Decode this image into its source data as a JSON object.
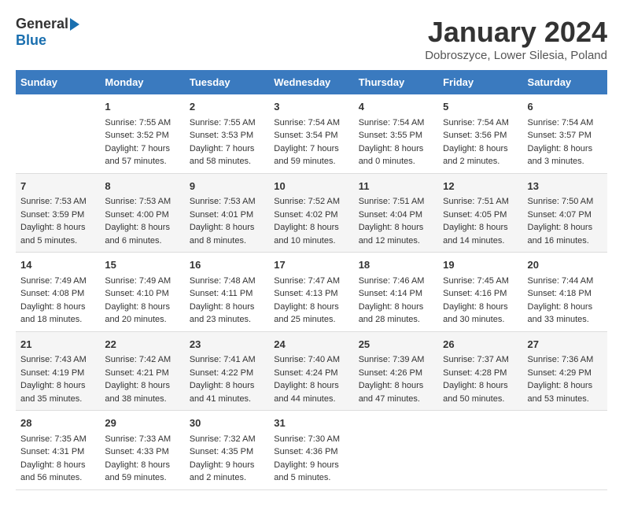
{
  "logo": {
    "general": "General",
    "blue": "Blue"
  },
  "title": "January 2024",
  "location": "Dobroszyce, Lower Silesia, Poland",
  "days_of_week": [
    "Sunday",
    "Monday",
    "Tuesday",
    "Wednesday",
    "Thursday",
    "Friday",
    "Saturday"
  ],
  "weeks": [
    [
      {
        "day": "",
        "content": ""
      },
      {
        "day": "1",
        "content": "Sunrise: 7:55 AM\nSunset: 3:52 PM\nDaylight: 7 hours\nand 57 minutes."
      },
      {
        "day": "2",
        "content": "Sunrise: 7:55 AM\nSunset: 3:53 PM\nDaylight: 7 hours\nand 58 minutes."
      },
      {
        "day": "3",
        "content": "Sunrise: 7:54 AM\nSunset: 3:54 PM\nDaylight: 7 hours\nand 59 minutes."
      },
      {
        "day": "4",
        "content": "Sunrise: 7:54 AM\nSunset: 3:55 PM\nDaylight: 8 hours\nand 0 minutes."
      },
      {
        "day": "5",
        "content": "Sunrise: 7:54 AM\nSunset: 3:56 PM\nDaylight: 8 hours\nand 2 minutes."
      },
      {
        "day": "6",
        "content": "Sunrise: 7:54 AM\nSunset: 3:57 PM\nDaylight: 8 hours\nand 3 minutes."
      }
    ],
    [
      {
        "day": "7",
        "content": "Sunrise: 7:53 AM\nSunset: 3:59 PM\nDaylight: 8 hours\nand 5 minutes."
      },
      {
        "day": "8",
        "content": "Sunrise: 7:53 AM\nSunset: 4:00 PM\nDaylight: 8 hours\nand 6 minutes."
      },
      {
        "day": "9",
        "content": "Sunrise: 7:53 AM\nSunset: 4:01 PM\nDaylight: 8 hours\nand 8 minutes."
      },
      {
        "day": "10",
        "content": "Sunrise: 7:52 AM\nSunset: 4:02 PM\nDaylight: 8 hours\nand 10 minutes."
      },
      {
        "day": "11",
        "content": "Sunrise: 7:51 AM\nSunset: 4:04 PM\nDaylight: 8 hours\nand 12 minutes."
      },
      {
        "day": "12",
        "content": "Sunrise: 7:51 AM\nSunset: 4:05 PM\nDaylight: 8 hours\nand 14 minutes."
      },
      {
        "day": "13",
        "content": "Sunrise: 7:50 AM\nSunset: 4:07 PM\nDaylight: 8 hours\nand 16 minutes."
      }
    ],
    [
      {
        "day": "14",
        "content": "Sunrise: 7:49 AM\nSunset: 4:08 PM\nDaylight: 8 hours\nand 18 minutes."
      },
      {
        "day": "15",
        "content": "Sunrise: 7:49 AM\nSunset: 4:10 PM\nDaylight: 8 hours\nand 20 minutes."
      },
      {
        "day": "16",
        "content": "Sunrise: 7:48 AM\nSunset: 4:11 PM\nDaylight: 8 hours\nand 23 minutes."
      },
      {
        "day": "17",
        "content": "Sunrise: 7:47 AM\nSunset: 4:13 PM\nDaylight: 8 hours\nand 25 minutes."
      },
      {
        "day": "18",
        "content": "Sunrise: 7:46 AM\nSunset: 4:14 PM\nDaylight: 8 hours\nand 28 minutes."
      },
      {
        "day": "19",
        "content": "Sunrise: 7:45 AM\nSunset: 4:16 PM\nDaylight: 8 hours\nand 30 minutes."
      },
      {
        "day": "20",
        "content": "Sunrise: 7:44 AM\nSunset: 4:18 PM\nDaylight: 8 hours\nand 33 minutes."
      }
    ],
    [
      {
        "day": "21",
        "content": "Sunrise: 7:43 AM\nSunset: 4:19 PM\nDaylight: 8 hours\nand 35 minutes."
      },
      {
        "day": "22",
        "content": "Sunrise: 7:42 AM\nSunset: 4:21 PM\nDaylight: 8 hours\nand 38 minutes."
      },
      {
        "day": "23",
        "content": "Sunrise: 7:41 AM\nSunset: 4:22 PM\nDaylight: 8 hours\nand 41 minutes."
      },
      {
        "day": "24",
        "content": "Sunrise: 7:40 AM\nSunset: 4:24 PM\nDaylight: 8 hours\nand 44 minutes."
      },
      {
        "day": "25",
        "content": "Sunrise: 7:39 AM\nSunset: 4:26 PM\nDaylight: 8 hours\nand 47 minutes."
      },
      {
        "day": "26",
        "content": "Sunrise: 7:37 AM\nSunset: 4:28 PM\nDaylight: 8 hours\nand 50 minutes."
      },
      {
        "day": "27",
        "content": "Sunrise: 7:36 AM\nSunset: 4:29 PM\nDaylight: 8 hours\nand 53 minutes."
      }
    ],
    [
      {
        "day": "28",
        "content": "Sunrise: 7:35 AM\nSunset: 4:31 PM\nDaylight: 8 hours\nand 56 minutes."
      },
      {
        "day": "29",
        "content": "Sunrise: 7:33 AM\nSunset: 4:33 PM\nDaylight: 8 hours\nand 59 minutes."
      },
      {
        "day": "30",
        "content": "Sunrise: 7:32 AM\nSunset: 4:35 PM\nDaylight: 9 hours\nand 2 minutes."
      },
      {
        "day": "31",
        "content": "Sunrise: 7:30 AM\nSunset: 4:36 PM\nDaylight: 9 hours\nand 5 minutes."
      },
      {
        "day": "",
        "content": ""
      },
      {
        "day": "",
        "content": ""
      },
      {
        "day": "",
        "content": ""
      }
    ]
  ]
}
